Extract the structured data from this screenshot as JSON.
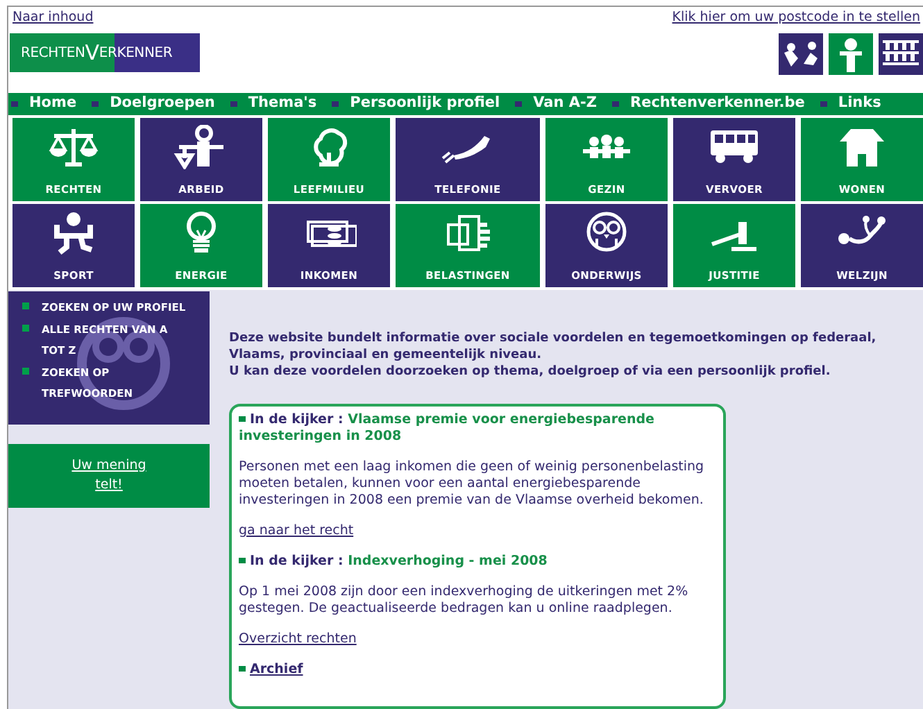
{
  "top_links": {
    "skip": "Naar inhoud",
    "postcode": "Klik hier om uw postcode in te stellen"
  },
  "logo": {
    "left": "RECHTEN",
    "mark": "V",
    "right": "ERKENNER"
  },
  "nav": [
    "Home",
    "Doelgroepen",
    "Thema's",
    "Persoonlijk profiel",
    "Van A-Z",
    "Rechtenverkenner.be",
    "Links"
  ],
  "tiles": [
    {
      "label": "RECHTEN",
      "color": "#008c45"
    },
    {
      "label": "ARBEID",
      "color": "#34296f"
    },
    {
      "label": "LEEFMILIEU",
      "color": "#008c45"
    },
    {
      "label": "TELEFONIE",
      "color": "#34296f"
    },
    {
      "label": "GEZIN",
      "color": "#008c45"
    },
    {
      "label": "VERVOER",
      "color": "#34296f"
    },
    {
      "label": "WONEN",
      "color": "#008c45"
    },
    {
      "label": "SPORT",
      "color": "#34296f"
    },
    {
      "label": "ENERGIE",
      "color": "#008c45"
    },
    {
      "label": "INKOMEN",
      "color": "#34296f"
    },
    {
      "label": "BELASTINGEN",
      "color": "#008c45"
    },
    {
      "label": "ONDERWIJS",
      "color": "#34296f"
    },
    {
      "label": "JUSTITIE",
      "color": "#008c45"
    },
    {
      "label": "WELZIJN",
      "color": "#34296f"
    }
  ],
  "sidebar": {
    "items": [
      "ZOEKEN OP UW PROFIEL",
      "ALLE RECHTEN VAN A TOT Z",
      "ZOEKEN OP TREFWOORDEN"
    ]
  },
  "opinion_link": "Uw mening telt!",
  "intro": [
    "Deze website bundelt informatie over sociale voordelen en tegemoetkomingen op federaal, Vlaams, provinciaal en gemeentelijk niveau.",
    "U kan deze voordelen doorzoeken op thema, doelgroep of via een persoonlijk profiel."
  ],
  "news": [
    {
      "prefix": "In de kijker :",
      "title": "Vlaamse premie voor energiebesparende investeringen in 2008",
      "body": "Personen met een laag inkomen die geen of weinig personenbelasting moeten betalen, kunnen voor een aantal energiebesparende investeringen in 2008 een premie van de Vlaamse overheid bekomen.",
      "link": "ga naar het recht"
    },
    {
      "prefix": "In de kijker :",
      "title": "Indexverhoging - mei 2008",
      "body": "Op 1 mei 2008 zijn door een indexverhoging de uitkeringen met 2% gestegen. De geactualiseerde bedragen kan u online raadplegen.",
      "link": "Overzicht rechten"
    }
  ],
  "archive": "Archief"
}
